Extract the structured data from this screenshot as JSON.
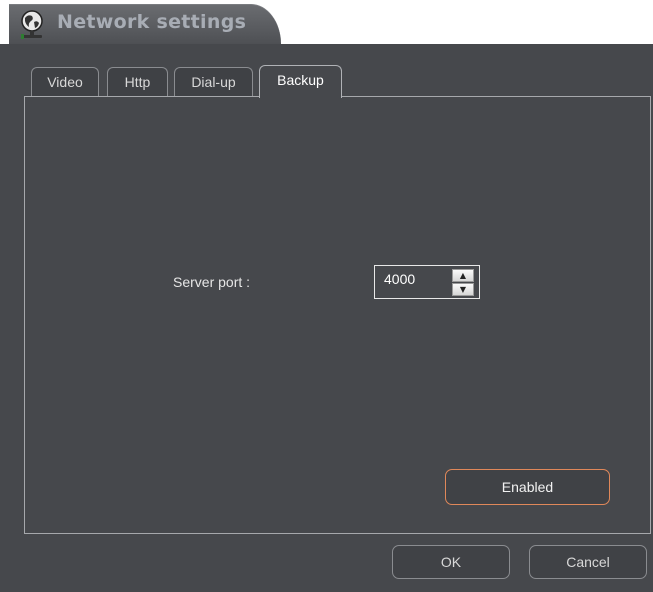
{
  "window": {
    "title": "Network settings",
    "title_icon": "webcam-globe-icon"
  },
  "tabs": [
    {
      "label": "Video",
      "active": false
    },
    {
      "label": "Http",
      "active": false
    },
    {
      "label": "Dial-up",
      "active": false
    },
    {
      "label": "Backup",
      "active": true
    }
  ],
  "backup": {
    "server_port_label": "Server port :",
    "server_port_value": "4000",
    "enabled_label": "Enabled"
  },
  "footer": {
    "ok_label": "OK",
    "cancel_label": "Cancel"
  },
  "colors": {
    "background": "#46484c",
    "border": "#a6a8ac",
    "accent": "#e0885a",
    "text": "#e6e6e6"
  }
}
